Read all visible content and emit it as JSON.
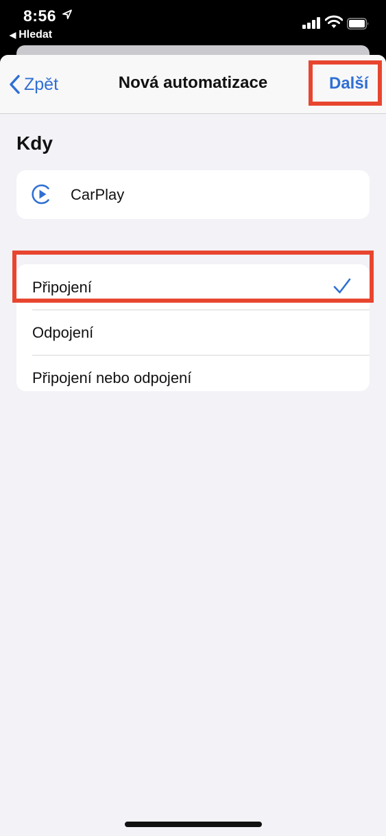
{
  "status_bar": {
    "time": "8:56",
    "back_app": "Hledat"
  },
  "navbar": {
    "back_label": "Zpět",
    "title": "Nová automatizace",
    "next_label": "Další"
  },
  "section": {
    "title": "Kdy"
  },
  "trigger": {
    "label": "CarPlay",
    "icon": "carplay-icon"
  },
  "options": [
    {
      "label": "Připojení",
      "selected": true
    },
    {
      "label": "Odpojení",
      "selected": false
    },
    {
      "label": "Připojení nebo odpojení",
      "selected": false
    }
  ],
  "colors": {
    "accent": "#2f6fd3",
    "highlight": "#e8452f",
    "background": "#f2f2f7"
  }
}
